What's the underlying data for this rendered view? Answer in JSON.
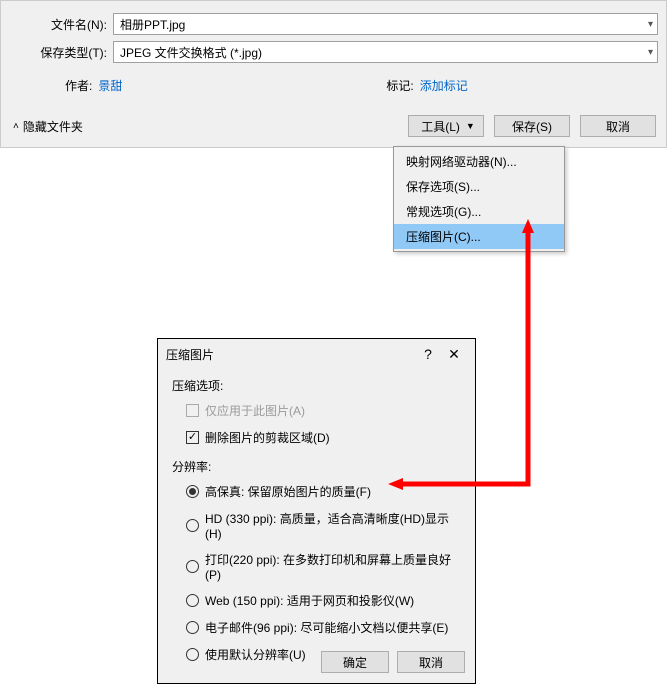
{
  "savePanel": {
    "fileNameLabel": "文件名(N):",
    "fileNameValue": "相册PPT.jpg",
    "saveTypeLabel": "保存类型(T):",
    "saveTypeValue": "JPEG 文件交换格式 (*.jpg)",
    "authorLabel": "作者:",
    "authorValue": "景甜",
    "tagLabel": "标记:",
    "tagValue": "添加标记",
    "hideFolders": "隐藏文件夹",
    "toolsBtn": "工具(L)",
    "saveBtn": "保存(S)",
    "cancelBtn": "取消"
  },
  "menu": {
    "items": [
      "映射网络驱动器(N)...",
      "保存选项(S)...",
      "常规选项(G)...",
      "压缩图片(C)..."
    ]
  },
  "dialog": {
    "title": "压缩图片",
    "compressOptionsLabel": "压缩选项:",
    "applyOnly": "仅应用于此图片(A)",
    "deleteCrop": "删除图片的剪裁区域(D)",
    "resolutionLabel": "分辨率:",
    "res": [
      "高保真: 保留原始图片的质量(F)",
      "HD (330 ppi): 高质量，适合高清晰度(HD)显示(H)",
      "打印(220 ppi): 在多数打印机和屏幕上质量良好(P)",
      "Web (150 ppi): 适用于网页和投影仪(W)",
      "电子邮件(96 ppi): 尽可能缩小文档以便共享(E)",
      "使用默认分辨率(U)"
    ],
    "ok": "确定",
    "cancel": "取消"
  }
}
